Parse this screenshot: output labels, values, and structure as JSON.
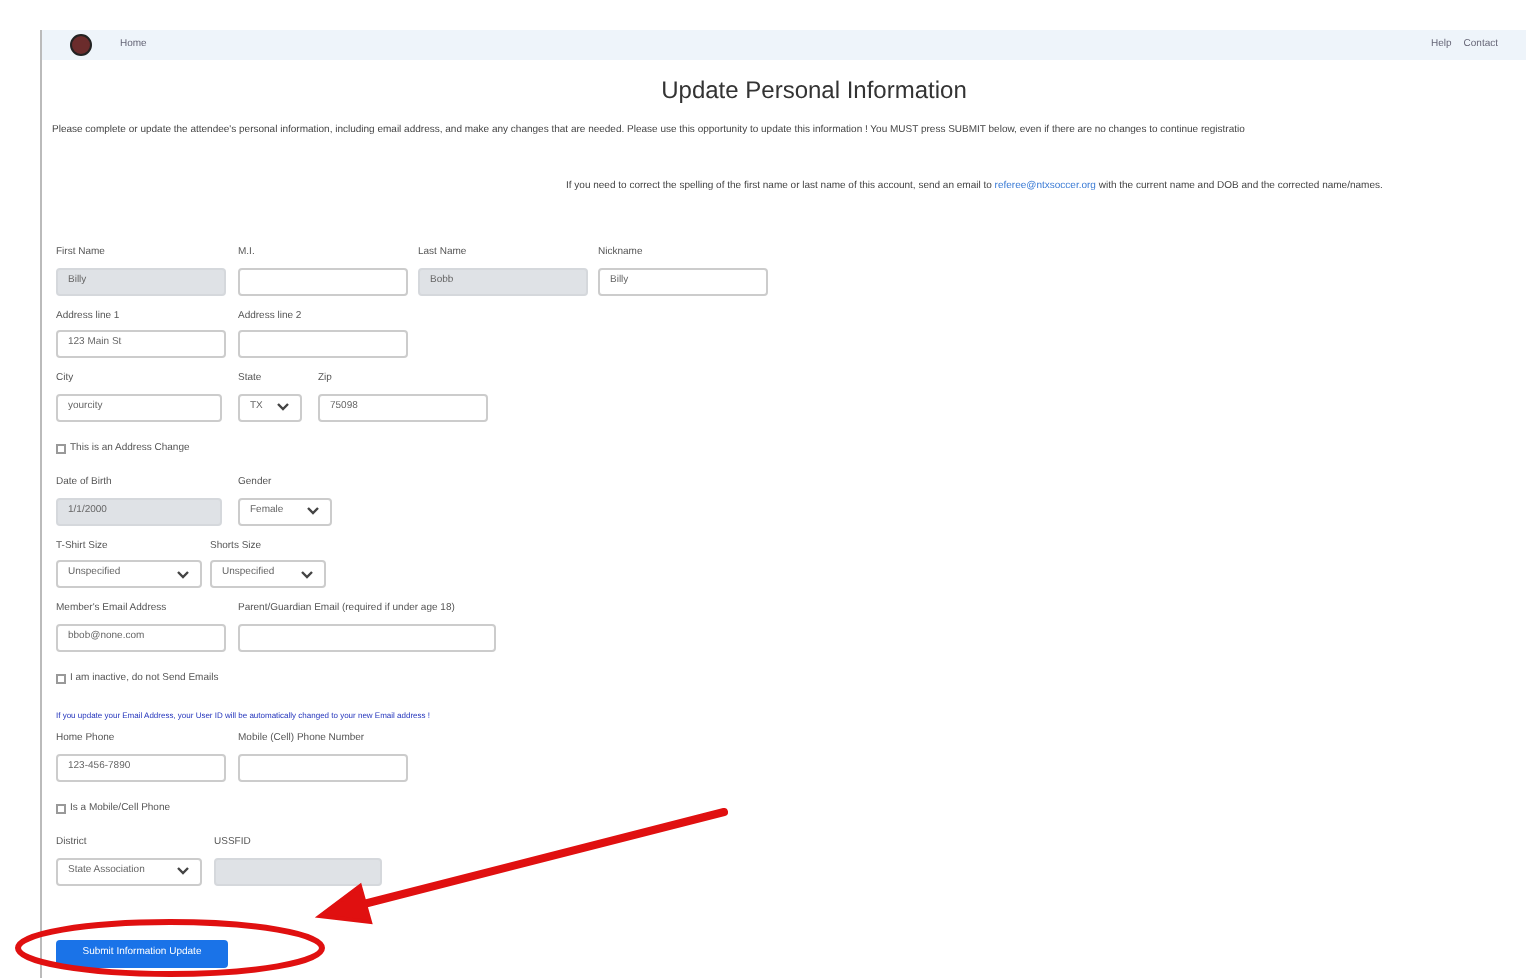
{
  "nav": {
    "home": "Home",
    "links": [
      "Help",
      "Contact"
    ]
  },
  "title": "Update Personal Information",
  "intro": "Please complete or update the attendee's personal information, including email address, and make any changes that are needed. Please use this opportunity to update this information !  You MUST press SUBMIT below, even if there are no changes to continue registratio",
  "name_note": {
    "before": "If you need to correct the spelling of the first name or last name of this account, send an email to",
    "link": "referee@ntxsoccer.org",
    "after": "with the current name and DOB and the corrected name/names."
  },
  "rows": [
    {
      "kind": "fields",
      "fields": [
        {
          "kind": "text",
          "label": "First Name",
          "value": "Billy",
          "disabled": true
        },
        {
          "kind": "text",
          "label": "M.I.",
          "disabled": false
        },
        {
          "kind": "text",
          "label": "Last Name",
          "value": "Bobb",
          "disabled": true
        },
        {
          "kind": "text",
          "label": "Nickname",
          "value": "Billy",
          "disabled": false
        }
      ]
    },
    {
      "kind": "fields",
      "fields": [
        {
          "kind": "text",
          "label": "Address line 1",
          "value": "123 Main St",
          "disabled": false
        },
        {
          "kind": "text",
          "label": "Address line 2",
          "disabled": false
        }
      ]
    },
    {
      "kind": "fields",
      "fields": [
        {
          "kind": "text",
          "label": "City",
          "value": "yourcity",
          "disabled": false
        },
        {
          "kind": "select",
          "label": "State",
          "value": "TX",
          "disabled": false
        },
        {
          "kind": "text",
          "label": "Zip",
          "value": "75098",
          "disabled": false
        }
      ]
    },
    {
      "kind": "checkbox",
      "label": "This is an Address Change",
      "checked": false
    },
    {
      "kind": "fields",
      "fields": [
        {
          "kind": "text",
          "label": "Date of Birth",
          "value": "1/1/2000",
          "disabled": true
        },
        {
          "kind": "select",
          "label": "Gender",
          "value": "Female",
          "disabled": false
        }
      ]
    },
    {
      "kind": "fields",
      "fields": [
        {
          "kind": "select",
          "label": "T-Shirt Size",
          "value": "Unspecified",
          "disabled": false
        },
        {
          "kind": "select",
          "label": "Shorts Size",
          "value": "Unspecified",
          "disabled": false
        }
      ]
    },
    {
      "kind": "fields",
      "fields": [
        {
          "kind": "text",
          "label": "Member's Email Address",
          "value": "bbob@none.com",
          "disabled": false
        },
        {
          "kind": "text",
          "label": "Parent/Guardian Email (required if under age 18)",
          "disabled": false
        }
      ]
    },
    {
      "kind": "checkbox",
      "label": "I am inactive, do not Send Emails",
      "checked": false
    },
    {
      "kind": "note",
      "text": "If you update your Email Address, your User ID will be automatically changed to your new Email address !"
    },
    {
      "kind": "fields",
      "fields": [
        {
          "kind": "text",
          "label": "Home Phone",
          "value": "123-456-7890",
          "disabled": false
        },
        {
          "kind": "text",
          "label": "Mobile (Cell) Phone Number",
          "disabled": false
        }
      ]
    },
    {
      "kind": "checkbox",
      "label": "Is a Mobile/Cell Phone",
      "checked": false
    },
    {
      "kind": "fields",
      "fields": [
        {
          "kind": "select",
          "label": "District",
          "value": "State Association",
          "disabled": false
        },
        {
          "kind": "text",
          "label": "USSFID",
          "disabled": true
        }
      ]
    }
  ],
  "submit": "Submit Information Update"
}
